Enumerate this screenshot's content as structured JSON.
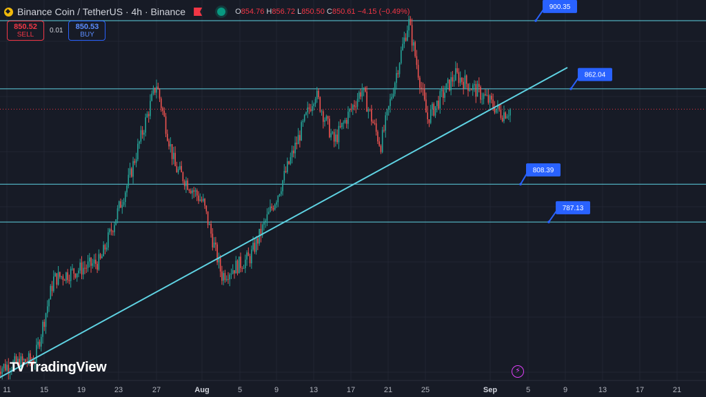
{
  "header": {
    "title": "Binance Coin / TetherUS · 4h · Binance",
    "open_label": "O",
    "open": "854.76",
    "high_label": "H",
    "high": "856.72",
    "low_label": "L",
    "low": "850.50",
    "close_label": "C",
    "close": "850.61",
    "change": "−4.15 (−0.49%)"
  },
  "trade": {
    "sell_price": "850.52",
    "sell_label": "SELL",
    "spread": "0.01",
    "buy_price": "850.53",
    "buy_label": "BUY"
  },
  "branding": {
    "logo_mark": "TV",
    "logo_text": "TradingView"
  },
  "icons": {
    "coin": "binance-coin-icon",
    "flag": "flag-icon",
    "live": "market-open-icon",
    "bolt": "lightning-icon"
  },
  "colors": {
    "background": "#171b26",
    "up": "#26a69a",
    "down": "#ef5350",
    "line": "#5fd3e3",
    "label": "#2962ff",
    "current": "#f23645"
  },
  "chart_data": {
    "type": "candlestick",
    "title": "",
    "x_ticks": [
      "11",
      "15",
      "19",
      "23",
      "27",
      "Aug",
      "5",
      "9",
      "13",
      "17",
      "21",
      "25",
      "Sep",
      "5",
      "9",
      "13",
      "17",
      "21"
    ],
    "ylim": [
      698,
      912
    ],
    "current_price": 850.61,
    "horizontal_levels": [
      900.35,
      862.04,
      808.39,
      787.13
    ],
    "level_labels": [
      "900.35",
      "862.04",
      "808.39",
      "787.13"
    ],
    "trendline": {
      "from": {
        "date": "Jul 10",
        "price": 699
      },
      "to": {
        "date": "Sep 9",
        "price": 874
      }
    },
    "key_points": [
      {
        "date": "Jul 10",
        "price": 705
      },
      {
        "date": "Jul 14",
        "price": 710
      },
      {
        "date": "Jul 16",
        "price": 755
      },
      {
        "date": "Jul 21",
        "price": 765
      },
      {
        "date": "Jul 24",
        "price": 810
      },
      {
        "date": "Jul 27",
        "price": 865
      },
      {
        "date": "Jul 29",
        "price": 818
      },
      {
        "date": "Aug 1",
        "price": 798
      },
      {
        "date": "Aug 3",
        "price": 757
      },
      {
        "date": "Aug 6",
        "price": 767
      },
      {
        "date": "Aug 9",
        "price": 803
      },
      {
        "date": "Aug 13",
        "price": 860
      },
      {
        "date": "Aug 15",
        "price": 832
      },
      {
        "date": "Aug 18",
        "price": 862
      },
      {
        "date": "Aug 20",
        "price": 830
      },
      {
        "date": "Aug 22",
        "price": 878
      },
      {
        "date": "Aug 23",
        "price": 900
      },
      {
        "date": "Aug 25",
        "price": 845
      },
      {
        "date": "Aug 28",
        "price": 870
      },
      {
        "date": "Aug 31",
        "price": 858
      },
      {
        "date": "Sep 2",
        "price": 848
      },
      {
        "date": "Sep 3",
        "price": 850.61
      }
    ]
  }
}
